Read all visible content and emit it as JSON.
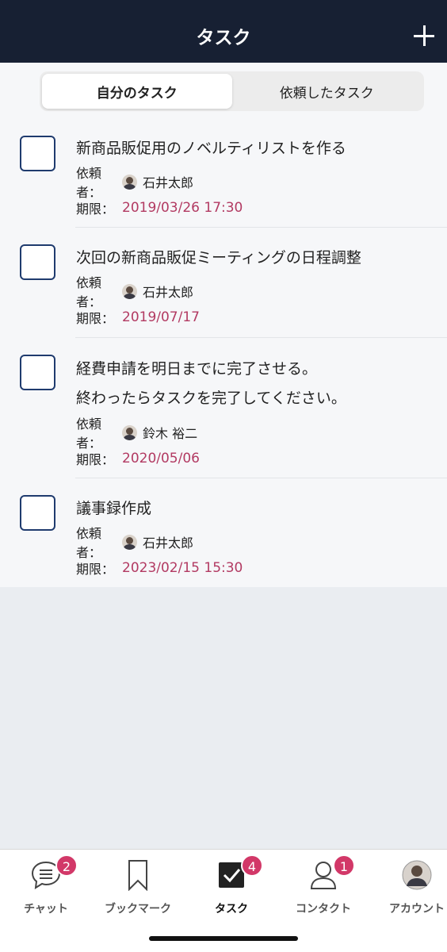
{
  "header": {
    "title": "タスク"
  },
  "segments": {
    "mine": "自分のタスク",
    "requested": "依頼したタスク"
  },
  "labels": {
    "requester": "依頼者：",
    "due": "期限："
  },
  "tasks": [
    {
      "title": "新商品販促用のノベルティリストを作る",
      "requester": "石井太郎",
      "due": "2019/03/26 17:30"
    },
    {
      "title": "次回の新商品販促ミーティングの日程調整",
      "requester": "石井太郎",
      "due": "2019/07/17"
    },
    {
      "title": "経費申請を明日までに完了させる。\n終わったらタスクを完了してください。",
      "requester": "鈴木 裕二",
      "due": "2020/05/06"
    },
    {
      "title": "議事録作成",
      "requester": "石井太郎",
      "due": "2023/02/15 15:30"
    }
  ],
  "tabbar": {
    "chat": {
      "label": "チャット",
      "badge": "2"
    },
    "bookmark": {
      "label": "ブックマーク"
    },
    "task": {
      "label": "タスク",
      "badge": "4"
    },
    "contact": {
      "label": "コンタクト",
      "badge": "1"
    },
    "account": {
      "label": "アカウント"
    }
  },
  "colors": {
    "header_bg": "#172033",
    "due": "#b23a62",
    "badge": "#d23868",
    "checkbox_border": "#1f3b6e"
  }
}
